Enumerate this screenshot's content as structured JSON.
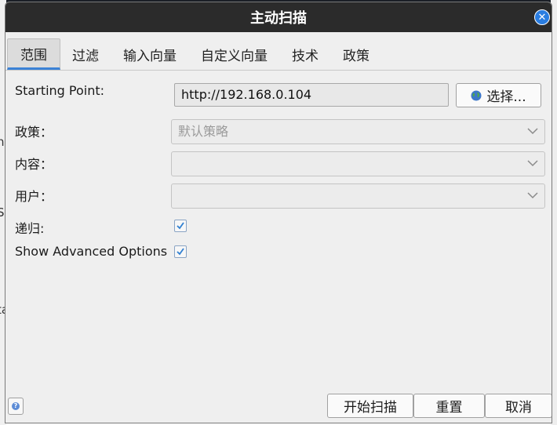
{
  "dialog": {
    "title": "主动扫描",
    "close_glyph": "✕"
  },
  "tabs": [
    {
      "label": "范围",
      "active": true
    },
    {
      "label": "过滤",
      "active": false
    },
    {
      "label": "输入向量",
      "active": false
    },
    {
      "label": "自定义向量",
      "active": false
    },
    {
      "label": "技术",
      "active": false
    },
    {
      "label": "政策",
      "active": false
    }
  ],
  "form": {
    "starting_point_label": "Starting Point:",
    "starting_point_value": "http://192.168.0.104",
    "choose_button_label": "选择...",
    "policy_label": "政策：",
    "policy_value": "默认策略",
    "context_label": "内容：",
    "context_value": "",
    "user_label": "用户：",
    "user_value": "",
    "recurse_label": "递归:",
    "recurse_checked": true,
    "advanced_label": "Show Advanced Options",
    "advanced_checked": true
  },
  "footer": {
    "help_glyph": "?",
    "start_scan_label": "开始扫描",
    "reset_label": "重置",
    "cancel_label": "取消"
  },
  "background": {
    "left_glyphs": [
      "n",
      "S",
      "ta"
    ]
  },
  "colors": {
    "titlebar": "#2b2b2b",
    "accent": "#3b82d6",
    "close_button": "#2a7de1"
  }
}
